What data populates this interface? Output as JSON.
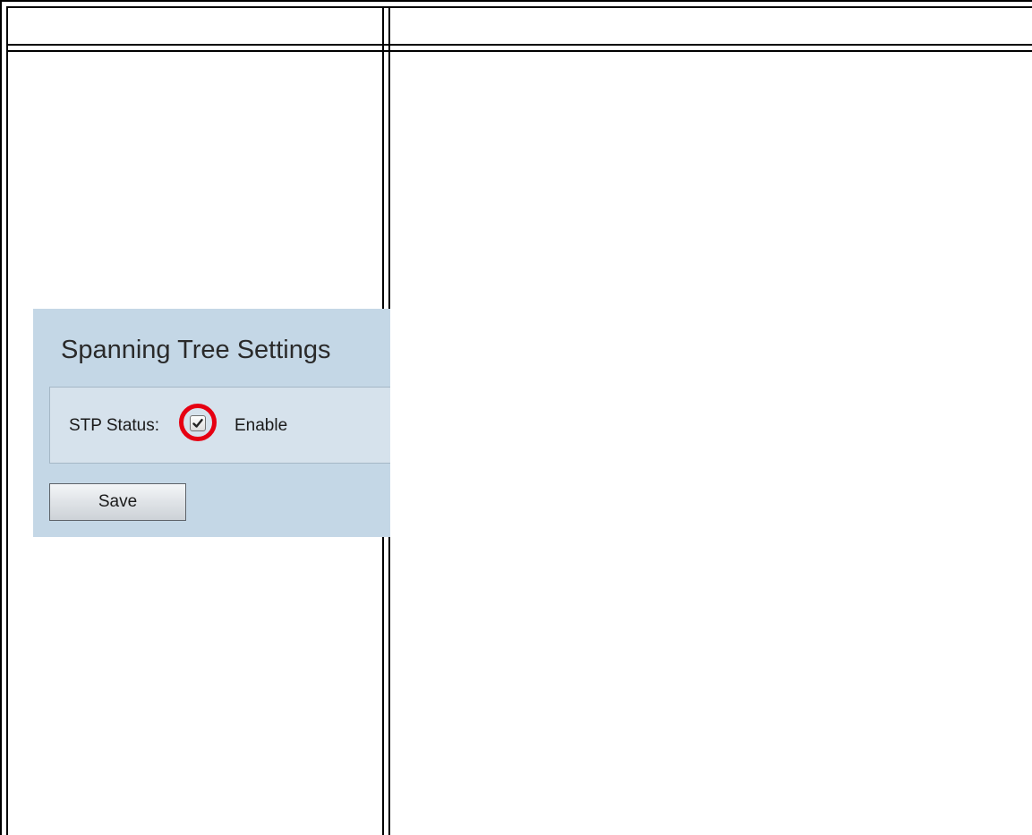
{
  "panel": {
    "title": "Spanning Tree Settings",
    "stp_status_label": "STP Status:",
    "stp_enabled": true,
    "enable_label": "Enable",
    "save_label": "Save"
  },
  "colors": {
    "panel_background": "#c4d7e6",
    "settings_box_background": "#d6e2ec",
    "highlight_ring": "#e60012"
  },
  "icons": {
    "checkbox_mark": "checkmark-icon"
  }
}
